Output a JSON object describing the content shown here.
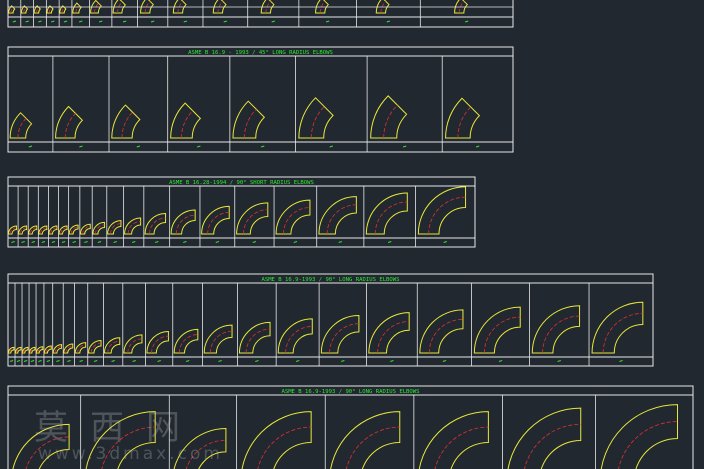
{
  "colors": {
    "background": "#212830",
    "frame": "#e8e8e8",
    "title": "#2ee82e",
    "elbow_outline": "#e8e83a",
    "centerline": "#e03030",
    "label": "#2ee82e"
  },
  "panels": [
    {
      "title": "",
      "angle": 45,
      "cells": 15,
      "label_rows": 2
    },
    {
      "title": "ASME B 16.9 - 1993 / 45° LONG RADIUS ELBOWS",
      "angle": 45,
      "cells": 8,
      "label_rows": 1
    },
    {
      "title": "ASME B 16.28-1994 / 90° SHORT RADIUS ELBOWS",
      "angle": 90,
      "cells": 19,
      "label_rows": 1
    },
    {
      "title": "ASME B 16.9-1993 / 90° LONG RADIUS ELBOWS",
      "angle": 90,
      "cells": 23,
      "label_rows": 1
    },
    {
      "title": "ASME B 16.9-1993 / 90° LONG RADIUS ELBOWS",
      "angle": 90,
      "cells": 9,
      "label_rows": 0
    }
  ],
  "watermark": {
    "chinese": "莫西网",
    "url": "www.3dmax.com"
  }
}
